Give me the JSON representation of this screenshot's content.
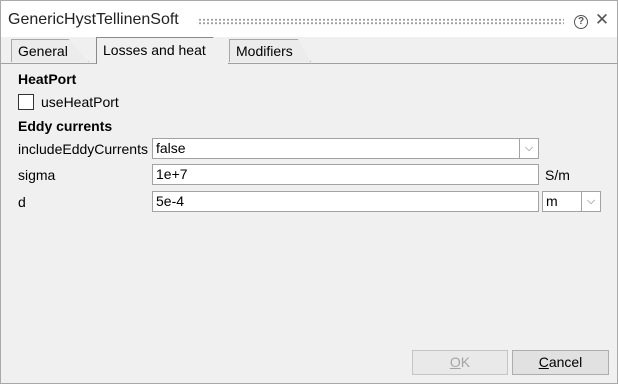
{
  "window": {
    "title": "GenericHystTellinenSoft"
  },
  "tabs": [
    {
      "label": "General"
    },
    {
      "label": "Losses and heat",
      "active": true
    },
    {
      "label": "Modifiers"
    }
  ],
  "heatport": {
    "section_title": "HeatPort",
    "use_label": "useHeatPort",
    "checked": false
  },
  "eddy": {
    "section_title": "Eddy currents",
    "include": {
      "label": "includeEddyCurrents",
      "value": "false"
    },
    "sigma": {
      "label": "sigma",
      "value": "1e+7",
      "unit": "S/m"
    },
    "d": {
      "label": "d",
      "value": "5e-4",
      "unit": "m"
    }
  },
  "buttons": {
    "ok": "OK",
    "cancel": "Cancel"
  },
  "icons": {
    "help": "help-icon",
    "close": "close-icon",
    "dropdown": "chevron-down-icon"
  }
}
